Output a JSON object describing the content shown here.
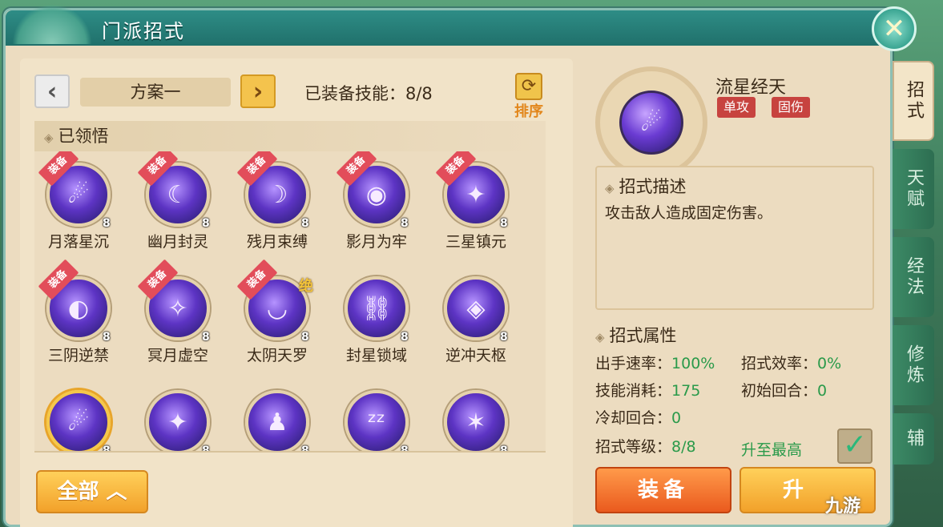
{
  "window": {
    "title": "门派招式"
  },
  "close_icon": "close-icon",
  "plan": {
    "name": "方案一",
    "prev_label": "‹",
    "next_label": "›",
    "equipped_text": "已装备技能：8/8",
    "sort_label": "排序"
  },
  "learned_header": "已领悟",
  "equip_ribbon_label": "装备",
  "jue_label": "绝",
  "skills": [
    {
      "name": "月落星沉",
      "level": "8",
      "equipped": true,
      "icon": "☄"
    },
    {
      "name": "幽月封灵",
      "level": "8",
      "equipped": true,
      "icon": "☾"
    },
    {
      "name": "残月束缚",
      "level": "8",
      "equipped": true,
      "icon": "☽"
    },
    {
      "name": "影月为牢",
      "level": "8",
      "equipped": true,
      "icon": "◉"
    },
    {
      "name": "三星镇元",
      "level": "8",
      "equipped": true,
      "icon": "✦"
    },
    {
      "name": "三阴逆禁",
      "level": "8",
      "equipped": true,
      "icon": "◐"
    },
    {
      "name": "冥月虚空",
      "level": "8",
      "equipped": true,
      "icon": "✧"
    },
    {
      "name": "太阴天罗",
      "level": "8",
      "equipped": true,
      "icon": "◡",
      "jue": true
    },
    {
      "name": "封星锁域",
      "level": "8",
      "equipped": false,
      "icon": "⛓"
    },
    {
      "name": "逆冲天枢",
      "level": "8",
      "equipped": false,
      "icon": "◈"
    },
    {
      "name": "",
      "level": "8",
      "equipped": false,
      "icon": "☄",
      "selected": true
    },
    {
      "name": "",
      "level": "8",
      "equipped": false,
      "icon": "✦"
    },
    {
      "name": "",
      "level": "8",
      "equipped": false,
      "icon": "♟"
    },
    {
      "name": "",
      "level": "8",
      "equipped": false,
      "icon": "ᶻᶻ"
    },
    {
      "name": "",
      "level": "8",
      "equipped": false,
      "icon": "✶"
    }
  ],
  "all_button": "全部 ︿",
  "detail": {
    "name": "流星经天",
    "icon": "☄",
    "tags": [
      "单攻",
      "固伤"
    ],
    "desc_title": "招式描述",
    "desc_text": "攻击敌人造成固定伤害。",
    "attr_title": "招式属性",
    "attrs": {
      "speed_label": "出手速率：",
      "speed_value": "100%",
      "efficiency_label": "招式效率：",
      "efficiency_value": "0%",
      "cost_label": "技能消耗：",
      "cost_value": "175",
      "initial_round_label": "初始回合：",
      "initial_round_value": "0",
      "cooldown_label": "冷却回合：",
      "cooldown_value": "0",
      "level_label": "招式等级：",
      "level_value": "8/8"
    },
    "max_text": "升至最高",
    "equip_button": "装备",
    "upgrade_button": "升"
  },
  "side_tabs": [
    {
      "label": "招式",
      "active": true
    },
    {
      "label": "天赋",
      "active": false
    },
    {
      "label": "经法",
      "active": false
    },
    {
      "label": "修炼",
      "active": false
    },
    {
      "label": "辅",
      "active": false
    }
  ],
  "watermark": "九游",
  "colors": {
    "accent_teal": "#20706b",
    "equip_red": "#e24d5a",
    "green_value": "#2a9a4a"
  }
}
